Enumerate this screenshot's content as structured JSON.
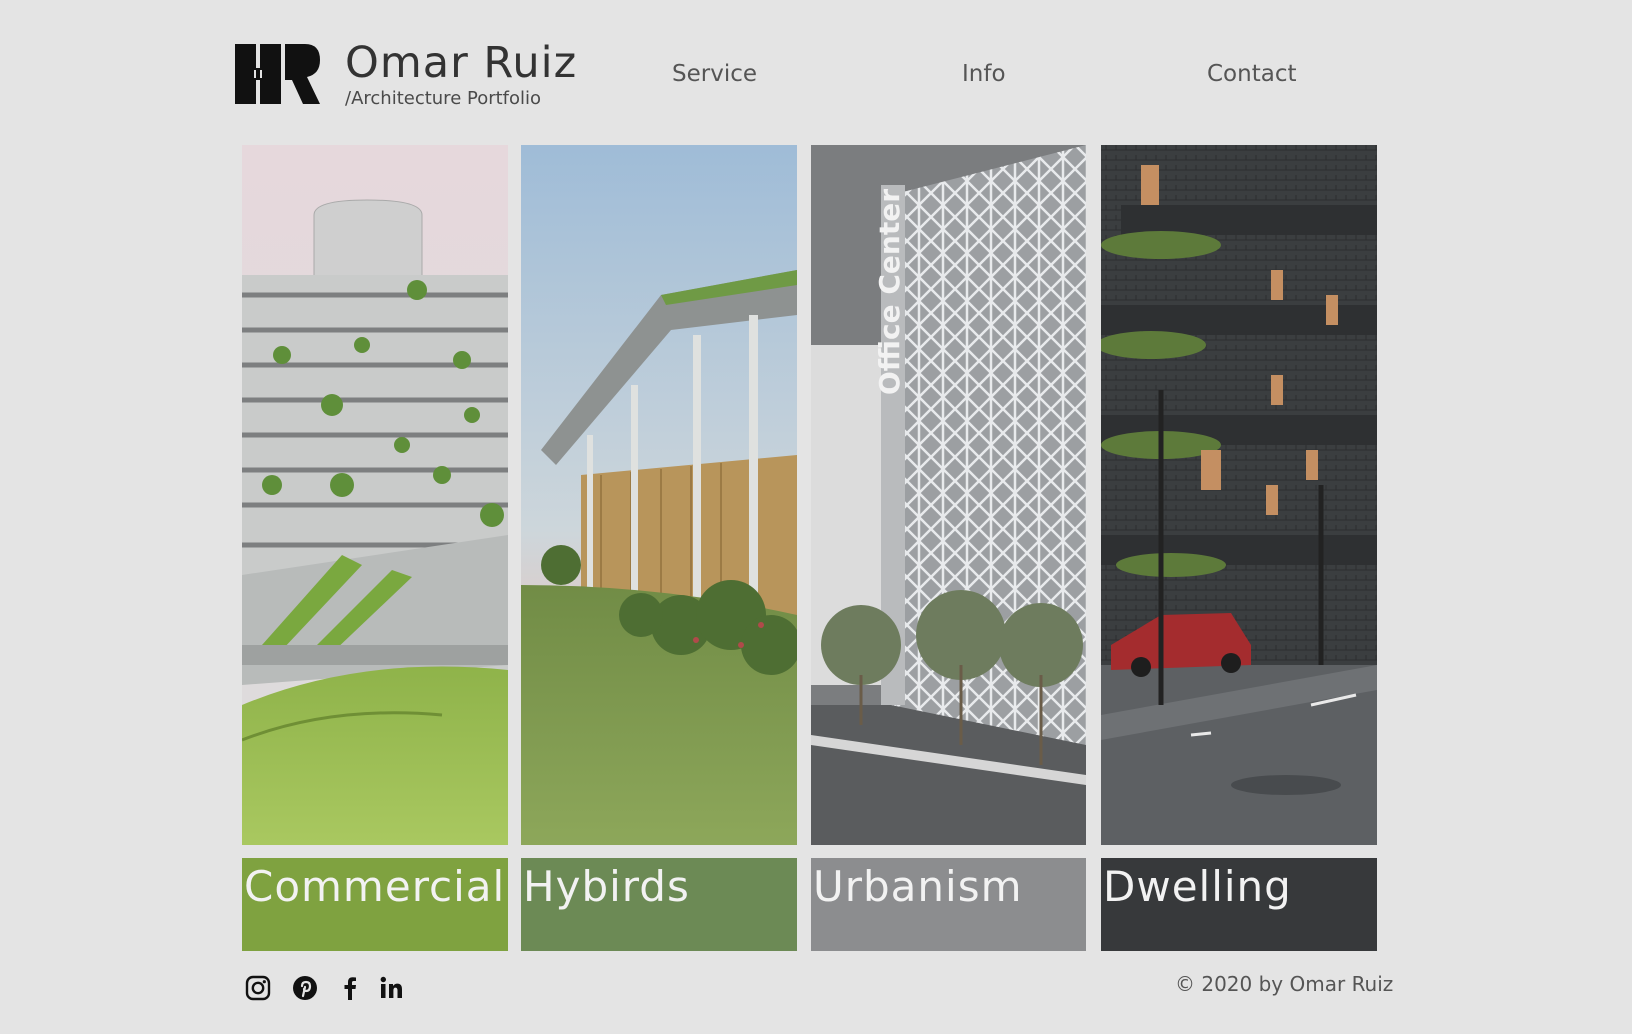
{
  "brand": {
    "name": "Omar Ruiz",
    "subtitle": "/Architecture Portfolio"
  },
  "nav": [
    {
      "label": "Service"
    },
    {
      "label": "Info"
    },
    {
      "label": "Contact"
    }
  ],
  "categories": [
    {
      "label": "Commercial",
      "color": "#7fa240"
    },
    {
      "label": "Hybirds",
      "color": "#6c8a55"
    },
    {
      "label": "Urbanism",
      "color": "#8c8d8f"
    },
    {
      "label": "Dwelling",
      "color": "#37393b"
    }
  ],
  "social": [
    "instagram-icon",
    "pinterest-icon",
    "facebook-icon",
    "linkedin-icon"
  ],
  "footer": {
    "copyright": "© 2020 by Omar Ruiz"
  },
  "image_signs": {
    "office_center": "Office Center"
  }
}
